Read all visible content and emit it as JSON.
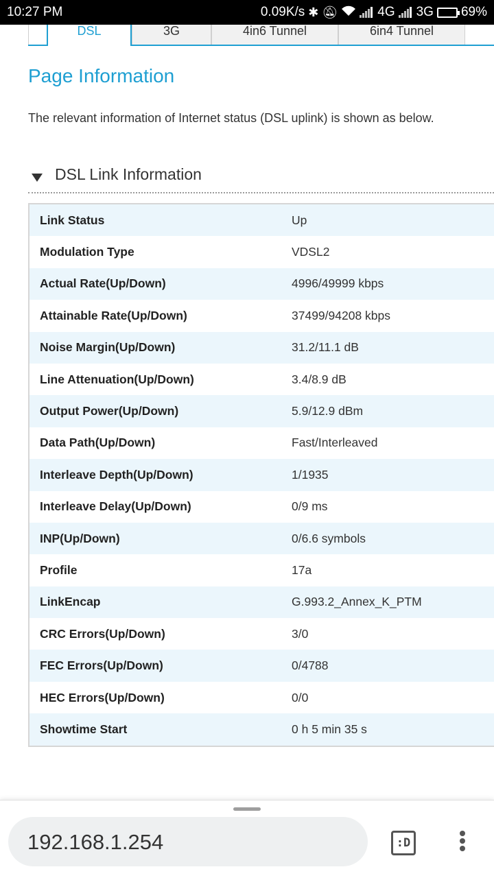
{
  "status_bar": {
    "time": "10:27 PM",
    "speed": "0.09K/s",
    "network_1": "4G",
    "network_2": "3G",
    "battery": "69%",
    "battery_level_percent": 69
  },
  "tabs": [
    {
      "label": "DSL",
      "active": true
    },
    {
      "label": "3G",
      "active": false
    },
    {
      "label": "4in6 Tunnel",
      "active": false
    },
    {
      "label": "6in4 Tunnel",
      "active": false
    }
  ],
  "page": {
    "title": "Page Information",
    "description": "The relevant information of Internet status (DSL uplink) is shown as below."
  },
  "section": {
    "title": "DSL Link Information"
  },
  "rows": [
    {
      "label": "Link Status",
      "value": "Up"
    },
    {
      "label": "Modulation Type",
      "value": "VDSL2"
    },
    {
      "label": "Actual Rate(Up/Down)",
      "value": "4996/49999 kbps"
    },
    {
      "label": "Attainable Rate(Up/Down)",
      "value": "37499/94208 kbps"
    },
    {
      "label": "Noise Margin(Up/Down)",
      "value": "31.2/11.1 dB"
    },
    {
      "label": "Line Attenuation(Up/Down)",
      "value": "3.4/8.9 dB"
    },
    {
      "label": "Output Power(Up/Down)",
      "value": "5.9/12.9 dBm"
    },
    {
      "label": "Data Path(Up/Down)",
      "value": "Fast/Interleaved"
    },
    {
      "label": "Interleave Depth(Up/Down)",
      "value": "1/1935"
    },
    {
      "label": "Interleave Delay(Up/Down)",
      "value": "0/9 ms"
    },
    {
      "label": "INP(Up/Down)",
      "value": "0/6.6 symbols"
    },
    {
      "label": "Profile",
      "value": "17a"
    },
    {
      "label": "LinkEncap",
      "value": "G.993.2_Annex_K_PTM"
    },
    {
      "label": "CRC Errors(Up/Down)",
      "value": "3/0"
    },
    {
      "label": "FEC Errors(Up/Down)",
      "value": "0/4788"
    },
    {
      "label": "HEC Errors(Up/Down)",
      "value": "0/0"
    },
    {
      "label": "Showtime Start",
      "value": "0 h 5 min 35 s"
    }
  ],
  "browser": {
    "url": "192.168.1.254",
    "tab_switcher_label": ":D"
  }
}
